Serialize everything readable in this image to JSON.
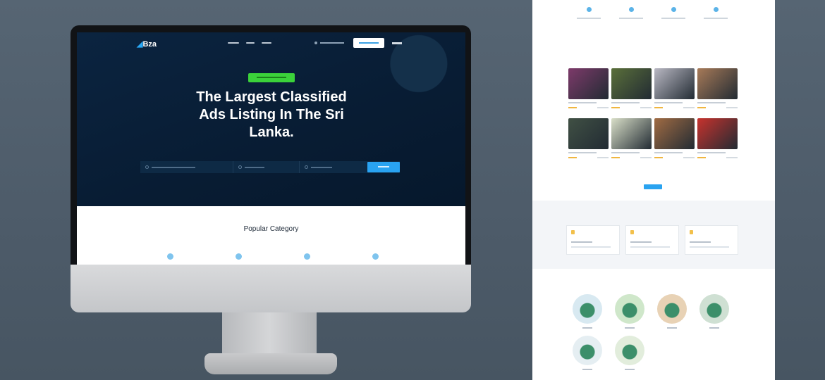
{
  "hero": {
    "logo_text": "Bza",
    "headline": "The Largest Classified Ads Listing In The Sri Lanka."
  },
  "categories": {
    "title": "Popular Category"
  },
  "featured_ads": {
    "photo_colors": [
      "#7d3a6a",
      "#5a6f3a",
      "#b9b8c3",
      "#a77a58",
      "#405044",
      "#d9dfc8",
      "#a06b43",
      "#c7322d"
    ]
  },
  "locations": {
    "circle_colors": [
      "#d8e9f1",
      "#cfe7ca",
      "#e8d2b5",
      "#cfe0d3",
      "#e5eef2",
      "#e2eddc"
    ]
  },
  "colors": {
    "accent": "#29a3f2",
    "hero_bg": "#081c33",
    "badge": "#3bd23a",
    "star": "#f0b640"
  }
}
